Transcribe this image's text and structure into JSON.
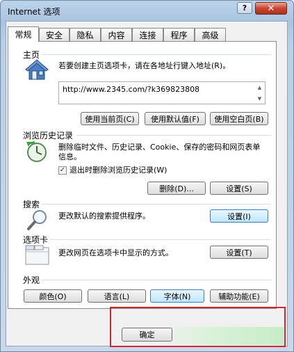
{
  "window": {
    "title": "Internet 选项",
    "help": "?",
    "close": "✕"
  },
  "tabs": [
    "常规",
    "安全",
    "隐私",
    "内容",
    "连接",
    "程序",
    "高级"
  ],
  "homepage": {
    "title": "主页",
    "desc": "若要创建主页选项卡，请在各地址行键入地址(R)。",
    "url": "http://www.2345.com/?k369823808",
    "btn_current": "使用当前页(C)",
    "btn_default": "使用默认值(F)",
    "btn_blank": "使用空白页(B)"
  },
  "history": {
    "title": "浏览历史记录",
    "desc": "删除临时文件、历史记录、Cookie、保存的密码和网页表单信息。",
    "checkbox_label": "退出时删除浏览历史记录(W)",
    "checked": true,
    "btn_delete": "删除(D)...",
    "btn_settings": "设置(S)"
  },
  "search": {
    "title": "搜索",
    "desc": "更改默认的搜索提供程序。",
    "btn_settings": "设置(I)"
  },
  "tabs_section": {
    "title": "选项卡",
    "desc": "更改网页在选项卡中显示的方式。",
    "btn_settings": "设置(T)"
  },
  "appearance": {
    "title": "外观",
    "btn_colors": "颜色(O)",
    "btn_languages": "语言(L)",
    "btn_fonts": "字体(N)",
    "btn_accessibility": "辅助功能(E)"
  },
  "footer": {
    "ok": "确定"
  }
}
